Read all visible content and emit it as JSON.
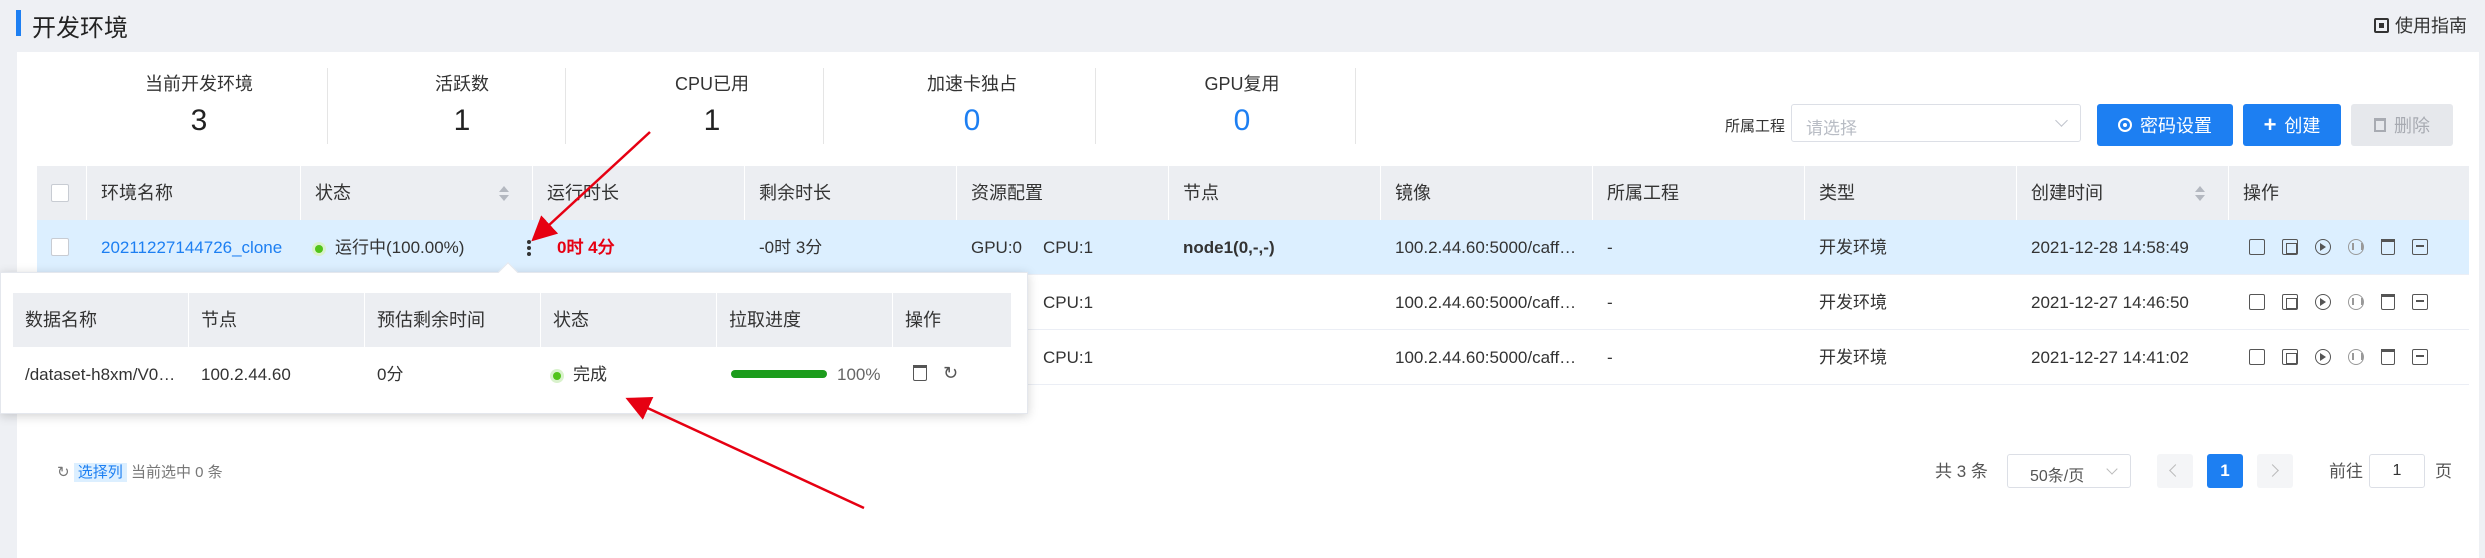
{
  "page": {
    "title": "开发环境",
    "guide_label": "使用指南"
  },
  "stats": [
    {
      "label": "当前开发环境",
      "value": "3",
      "highlight": false
    },
    {
      "label": "活跃数",
      "value": "1",
      "highlight": false
    },
    {
      "label": "CPU已用",
      "value": "1",
      "highlight": false
    },
    {
      "label": "加速卡独占",
      "value": "0",
      "highlight": true
    },
    {
      "label": "GPU复用",
      "value": "0",
      "highlight": true
    }
  ],
  "toolbar": {
    "project_label": "所属工程",
    "project_placeholder": "请选择",
    "password_button": "密码设置",
    "create_button": "创建",
    "delete_button": "删除"
  },
  "table": {
    "columns": [
      "环境名称",
      "状态",
      "运行时长",
      "剩余时长",
      "资源配置",
      "节点",
      "镜像",
      "所属工程",
      "类型",
      "创建时间",
      "操作"
    ],
    "rows": [
      {
        "name": "20211227144726_clone",
        "status": "运行中(100.00%)",
        "run_time": "0时 4分",
        "remain": "-0时 3分",
        "gpu": "GPU:0",
        "cpu": "CPU:1",
        "node": "node1(0,-,-)",
        "image": "100.2.44.60:5000/caff…",
        "project": "-",
        "type": "开发环境",
        "created": "2021-12-28 14:58:49"
      },
      {
        "name": "",
        "status": "",
        "run_time": "",
        "remain": "",
        "gpu": "",
        "cpu": "CPU:1",
        "node": "",
        "image": "100.2.44.60:5000/caff…",
        "project": "-",
        "type": "开发环境",
        "created": "2021-12-27 14:46:50"
      },
      {
        "name": "",
        "status": "",
        "run_time": "",
        "remain": "",
        "gpu": "",
        "cpu": "CPU:1",
        "node": "",
        "image": "100.2.44.60:5000/caff…",
        "project": "-",
        "type": "开发环境",
        "created": "2021-12-27 14:41:02"
      }
    ]
  },
  "footer": {
    "select_col_label": "选择列",
    "selected_text": "当前选中 0 条",
    "total": "共 3 条",
    "page_size": "50条/页",
    "current_page": "1",
    "goto_label": "前往",
    "goto_value": "1",
    "page_suffix": "页"
  },
  "popover": {
    "columns": [
      "数据名称",
      "节点",
      "预估剩余时间",
      "状态",
      "拉取进度",
      "操作"
    ],
    "row": {
      "data_name": "/dataset-h8xm/V0…",
      "node": "100.2.44.60",
      "eta": "0分",
      "status": "完成",
      "progress_label": "100%",
      "progress": 1.0
    }
  },
  "colors": {
    "accent": "#1d7ff2",
    "highlight_row": "#dcefff",
    "success": "#52c41a",
    "progress_fill": "#1c9c1c",
    "annotation_arrow": "#e60012"
  }
}
